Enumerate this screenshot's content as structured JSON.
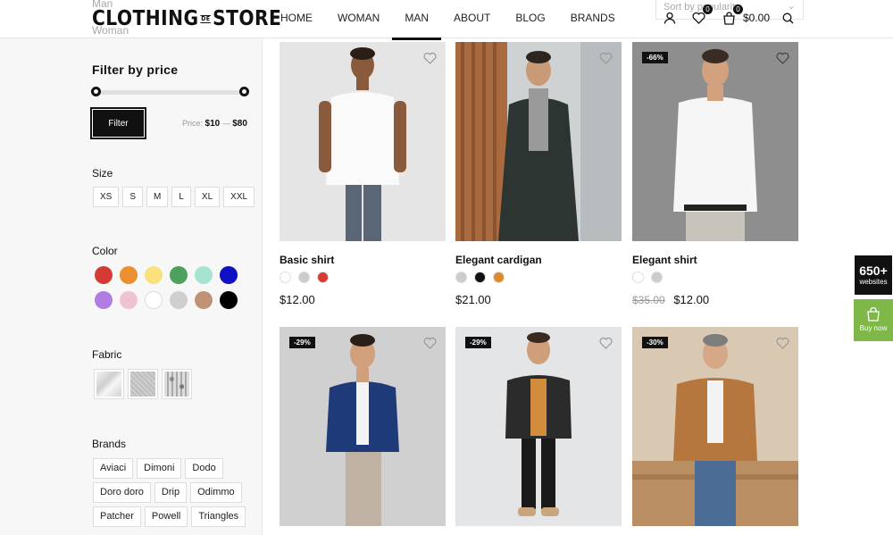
{
  "header": {
    "ghost_top": "Man",
    "ghost_bottom": "Woman",
    "logo_left": "CLOTHING",
    "logo_mid": "DE",
    "logo_right": "STORE",
    "nav": [
      "HOME",
      "WOMAN",
      "MAN",
      "ABOUT",
      "BLOG",
      "BRANDS"
    ],
    "active_nav": "MAN",
    "sort_placeholder": "Sort by popularity",
    "wishlist_count": "0",
    "cart_count": "0",
    "cart_total": "$0.00"
  },
  "sidebar": {
    "price_title": "Filter by price",
    "filter_button": "Filter",
    "price_prefix": "Price:",
    "price_min": "$10",
    "price_dash": "—",
    "price_max": "$80",
    "size_title": "Size",
    "sizes": [
      "XS",
      "S",
      "M",
      "L",
      "XL",
      "XXL"
    ],
    "color_title": "Color",
    "colors": [
      "#d33b34",
      "#ec8f2f",
      "#f9e27b",
      "#4ea05e",
      "#a6e3d2",
      "#1010c4",
      "#b07ee2",
      "#f0c3d2",
      "#ffffff",
      "#cfcfcf",
      "#c19375",
      "#000000"
    ],
    "fabric_title": "Fabric",
    "brands_title": "Brands",
    "brands": [
      "Aviaci",
      "Dimoni",
      "Dodo",
      "Doro doro",
      "Drip",
      "Odimmo",
      "Patcher",
      "Powell",
      "Triangles"
    ]
  },
  "products": [
    {
      "name": "Basic shirt",
      "price": "$12.00",
      "old_price": "",
      "discount": "",
      "swatches": [
        "#ffffff",
        "#cccccc",
        "#d33b34"
      ]
    },
    {
      "name": "Elegant cardigan",
      "price": "$21.00",
      "old_price": "",
      "discount": "",
      "swatches": [
        "#cccccc",
        "#111111",
        "#e08a2a"
      ]
    },
    {
      "name": "Elegant shirt",
      "price": "$12.00",
      "old_price": "$35.00",
      "discount": "-66%",
      "swatches": [
        "#ffffff",
        "#cccccc"
      ]
    },
    {
      "name": "",
      "price": "",
      "old_price": "",
      "discount": "-29%",
      "swatches": []
    },
    {
      "name": "",
      "price": "",
      "old_price": "",
      "discount": "-29%",
      "swatches": []
    },
    {
      "name": "",
      "price": "",
      "old_price": "",
      "discount": "-30%",
      "swatches": []
    }
  ],
  "promo": {
    "count": "650+",
    "label": "websites",
    "buy_label": "Buy now"
  }
}
